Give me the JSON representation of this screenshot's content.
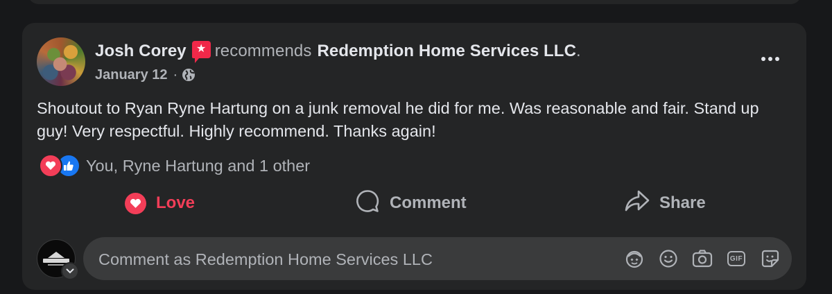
{
  "post": {
    "author": "Josh Corey",
    "verb": "recommends",
    "page_name": "Redemption Home Services LLC",
    "trailing_dot": ".",
    "date": "January 12",
    "date_sep": "·",
    "text": "Shoutout to Ryan Ryne Hartung on a junk removal he did for me. Was reasonable and fair. Stand up guy! Very respectful. Highly recommend. Thanks again!",
    "reactions_summary": "You, Ryne Hartung and 1 other",
    "reaction_types": [
      "love",
      "like"
    ]
  },
  "actions": {
    "love_label": "Love",
    "comment_label": "Comment",
    "share_label": "Share"
  },
  "composer": {
    "placeholder": "Comment as Redemption Home Services LLC",
    "tools": [
      "avatar-sticker-icon",
      "emoji-icon",
      "camera-icon",
      "gif-icon",
      "sticker-icon"
    ],
    "gif_label": "GIF"
  },
  "colors": {
    "background": "#17181a",
    "card": "#242526",
    "love": "#f33e58",
    "like": "#1877f2",
    "badge": "#f02849",
    "muted_text": "#b0b3b8",
    "primary_text": "#e4e6eb"
  }
}
